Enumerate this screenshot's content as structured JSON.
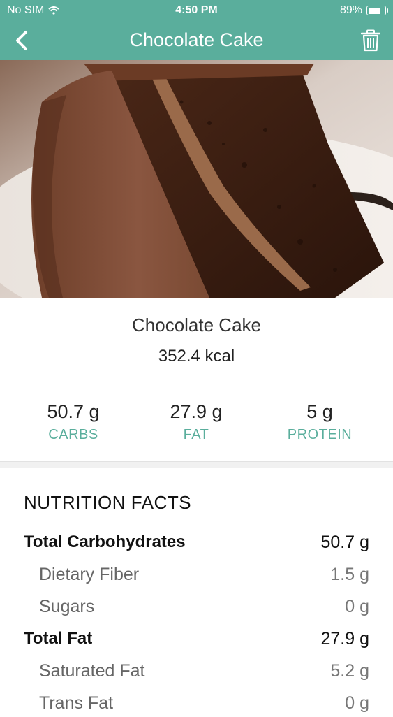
{
  "status": {
    "carrier": "No SIM",
    "time": "4:50 PM",
    "battery": "89%",
    "battery_level": 0.89
  },
  "nav": {
    "title": "Chocolate Cake"
  },
  "food": {
    "name": "Chocolate Cake",
    "calories": "352.4 kcal"
  },
  "macros": [
    {
      "value": "50.7 g",
      "label": "CARBS"
    },
    {
      "value": "27.9 g",
      "label": "FAT"
    },
    {
      "value": "5 g",
      "label": "PROTEIN"
    }
  ],
  "nutrition": {
    "header": "NUTRITION FACTS",
    "rows": [
      {
        "name": "Total Carbohydrates",
        "amount": "50.7 g"
      },
      {
        "name": "Dietary Fiber",
        "amount": "1.5 g"
      },
      {
        "name": "Sugars",
        "amount": "0 g"
      },
      {
        "name": "Total Fat",
        "amount": "27.9 g"
      },
      {
        "name": "Saturated Fat",
        "amount": "5.2 g"
      },
      {
        "name": "Trans Fat",
        "amount": "0 g"
      }
    ]
  },
  "colors": {
    "accent": "#5aae9c",
    "cake_dark": "#3a1f12",
    "frosting": "#7a4a33"
  },
  "icons": {
    "back": "chevron-left-icon",
    "delete": "trash-icon",
    "wifi": "wifi-icon",
    "battery": "battery-icon"
  }
}
